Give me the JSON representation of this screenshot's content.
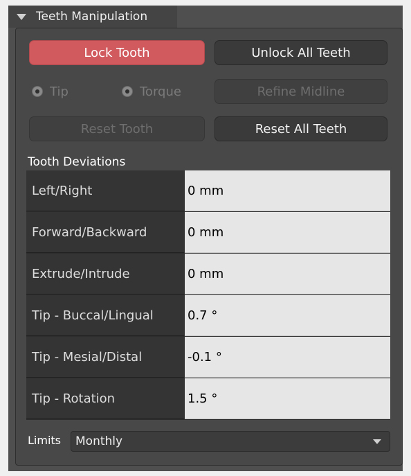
{
  "panel": {
    "title": "Teeth Manipulation"
  },
  "buttons": {
    "lock_tooth": "Lock Tooth",
    "unlock_all": "Unlock All Teeth",
    "refine_midline": "Refine Midline",
    "reset_tooth": "Reset Tooth",
    "reset_all": "Reset All Teeth"
  },
  "radios": {
    "tip": "Tip",
    "torque": "Torque"
  },
  "deviations": {
    "label": "Tooth Deviations",
    "rows": [
      {
        "key": "Left/Right",
        "value": "0 mm"
      },
      {
        "key": "Forward/Backward",
        "value": "0 mm"
      },
      {
        "key": "Extrude/Intrude",
        "value": "0 mm"
      },
      {
        "key": "Tip - Buccal/Lingual",
        "value": "0.7 °"
      },
      {
        "key": "Tip - Mesial/Distal",
        "value": "-0.1 °"
      },
      {
        "key": "Tip - Rotation",
        "value": "1.5 °"
      }
    ]
  },
  "limits": {
    "label": "Limits",
    "selected": "Monthly"
  },
  "colors": {
    "accent_red": "#d05a5e",
    "panel_bg": "#484848",
    "value_bg": "#e6e6e6"
  }
}
